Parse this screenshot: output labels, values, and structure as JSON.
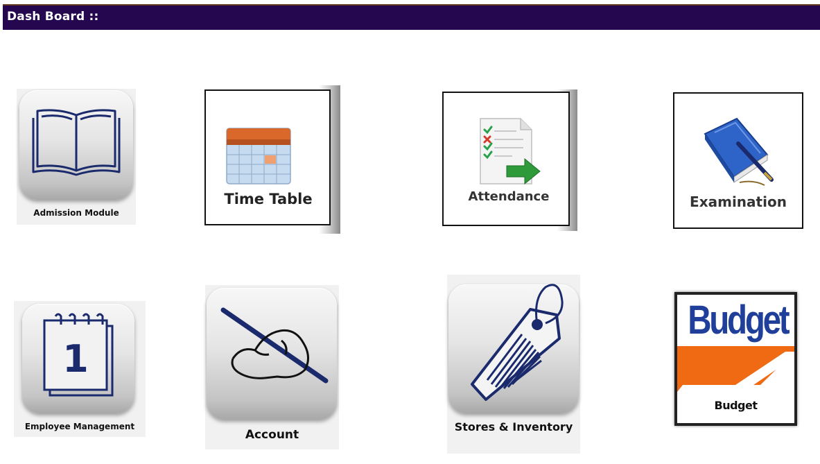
{
  "header": {
    "title": "Dash Board ::"
  },
  "modules": {
    "admission": {
      "label": "Admission Module",
      "icon": "open-book-icon"
    },
    "timetable": {
      "label": "Time Table",
      "icon": "calendar-icon"
    },
    "attendance": {
      "label": "Attendance",
      "icon": "checklist-arrow-icon"
    },
    "examination": {
      "label": "Examination",
      "icon": "book-pen-icon"
    },
    "employee": {
      "label": "Employee Management",
      "icon": "notepad-one-icon"
    },
    "account": {
      "label": "Account",
      "icon": "hand-writing-icon"
    },
    "stores": {
      "label": "Stores & Inventory",
      "icon": "barcode-tag-icon"
    },
    "budget": {
      "label": "Budget",
      "logo_text": "Budget",
      "icon": "budget-logo-icon"
    }
  },
  "colors": {
    "header_bg": "#250750",
    "icon_navy": "#1a2a6c",
    "budget_blue": "#1f3f9a",
    "budget_orange": "#ef6a12"
  }
}
